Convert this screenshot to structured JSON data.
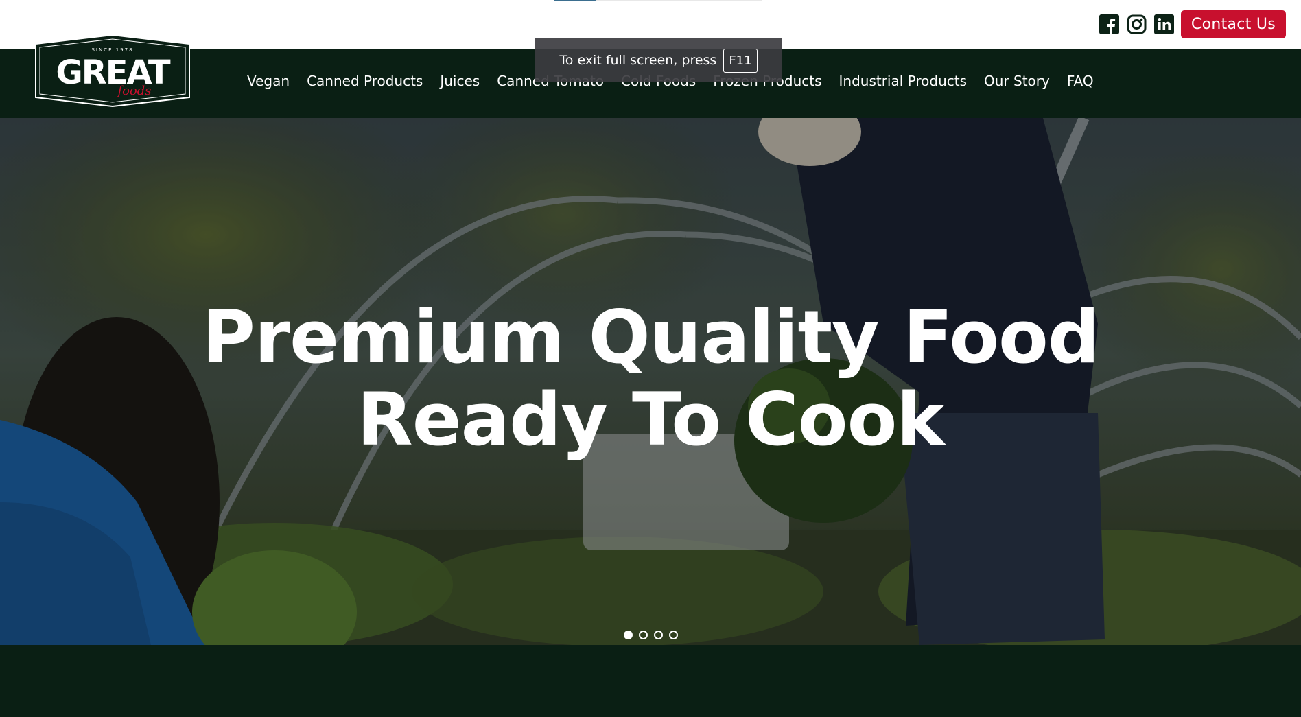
{
  "top_bar": {
    "progress": 0.2,
    "social_icons": [
      "facebook-icon",
      "instagram-icon",
      "linkedin-icon"
    ],
    "contact_label": "Contact Us"
  },
  "fullscreen_toast": {
    "message": "To exit full screen, press",
    "key": "F11"
  },
  "logo": {
    "tagline": "SINCE 1978",
    "word": "GREAT",
    "script": "foods"
  },
  "nav": {
    "items": [
      "Vegan",
      "Canned Products",
      "Juices",
      "Canned Tomato",
      "Cold Foods",
      "Frozen Products",
      "Industrial Products",
      "Our Story",
      "FAQ"
    ]
  },
  "hero": {
    "title_line1": "Premium Quality Food",
    "title_line2": "Ready To Cook",
    "slide_count": 4,
    "active_slide": 1
  },
  "colors": {
    "brand_dark": "#0a1f14",
    "accent_red": "#c8102e"
  }
}
